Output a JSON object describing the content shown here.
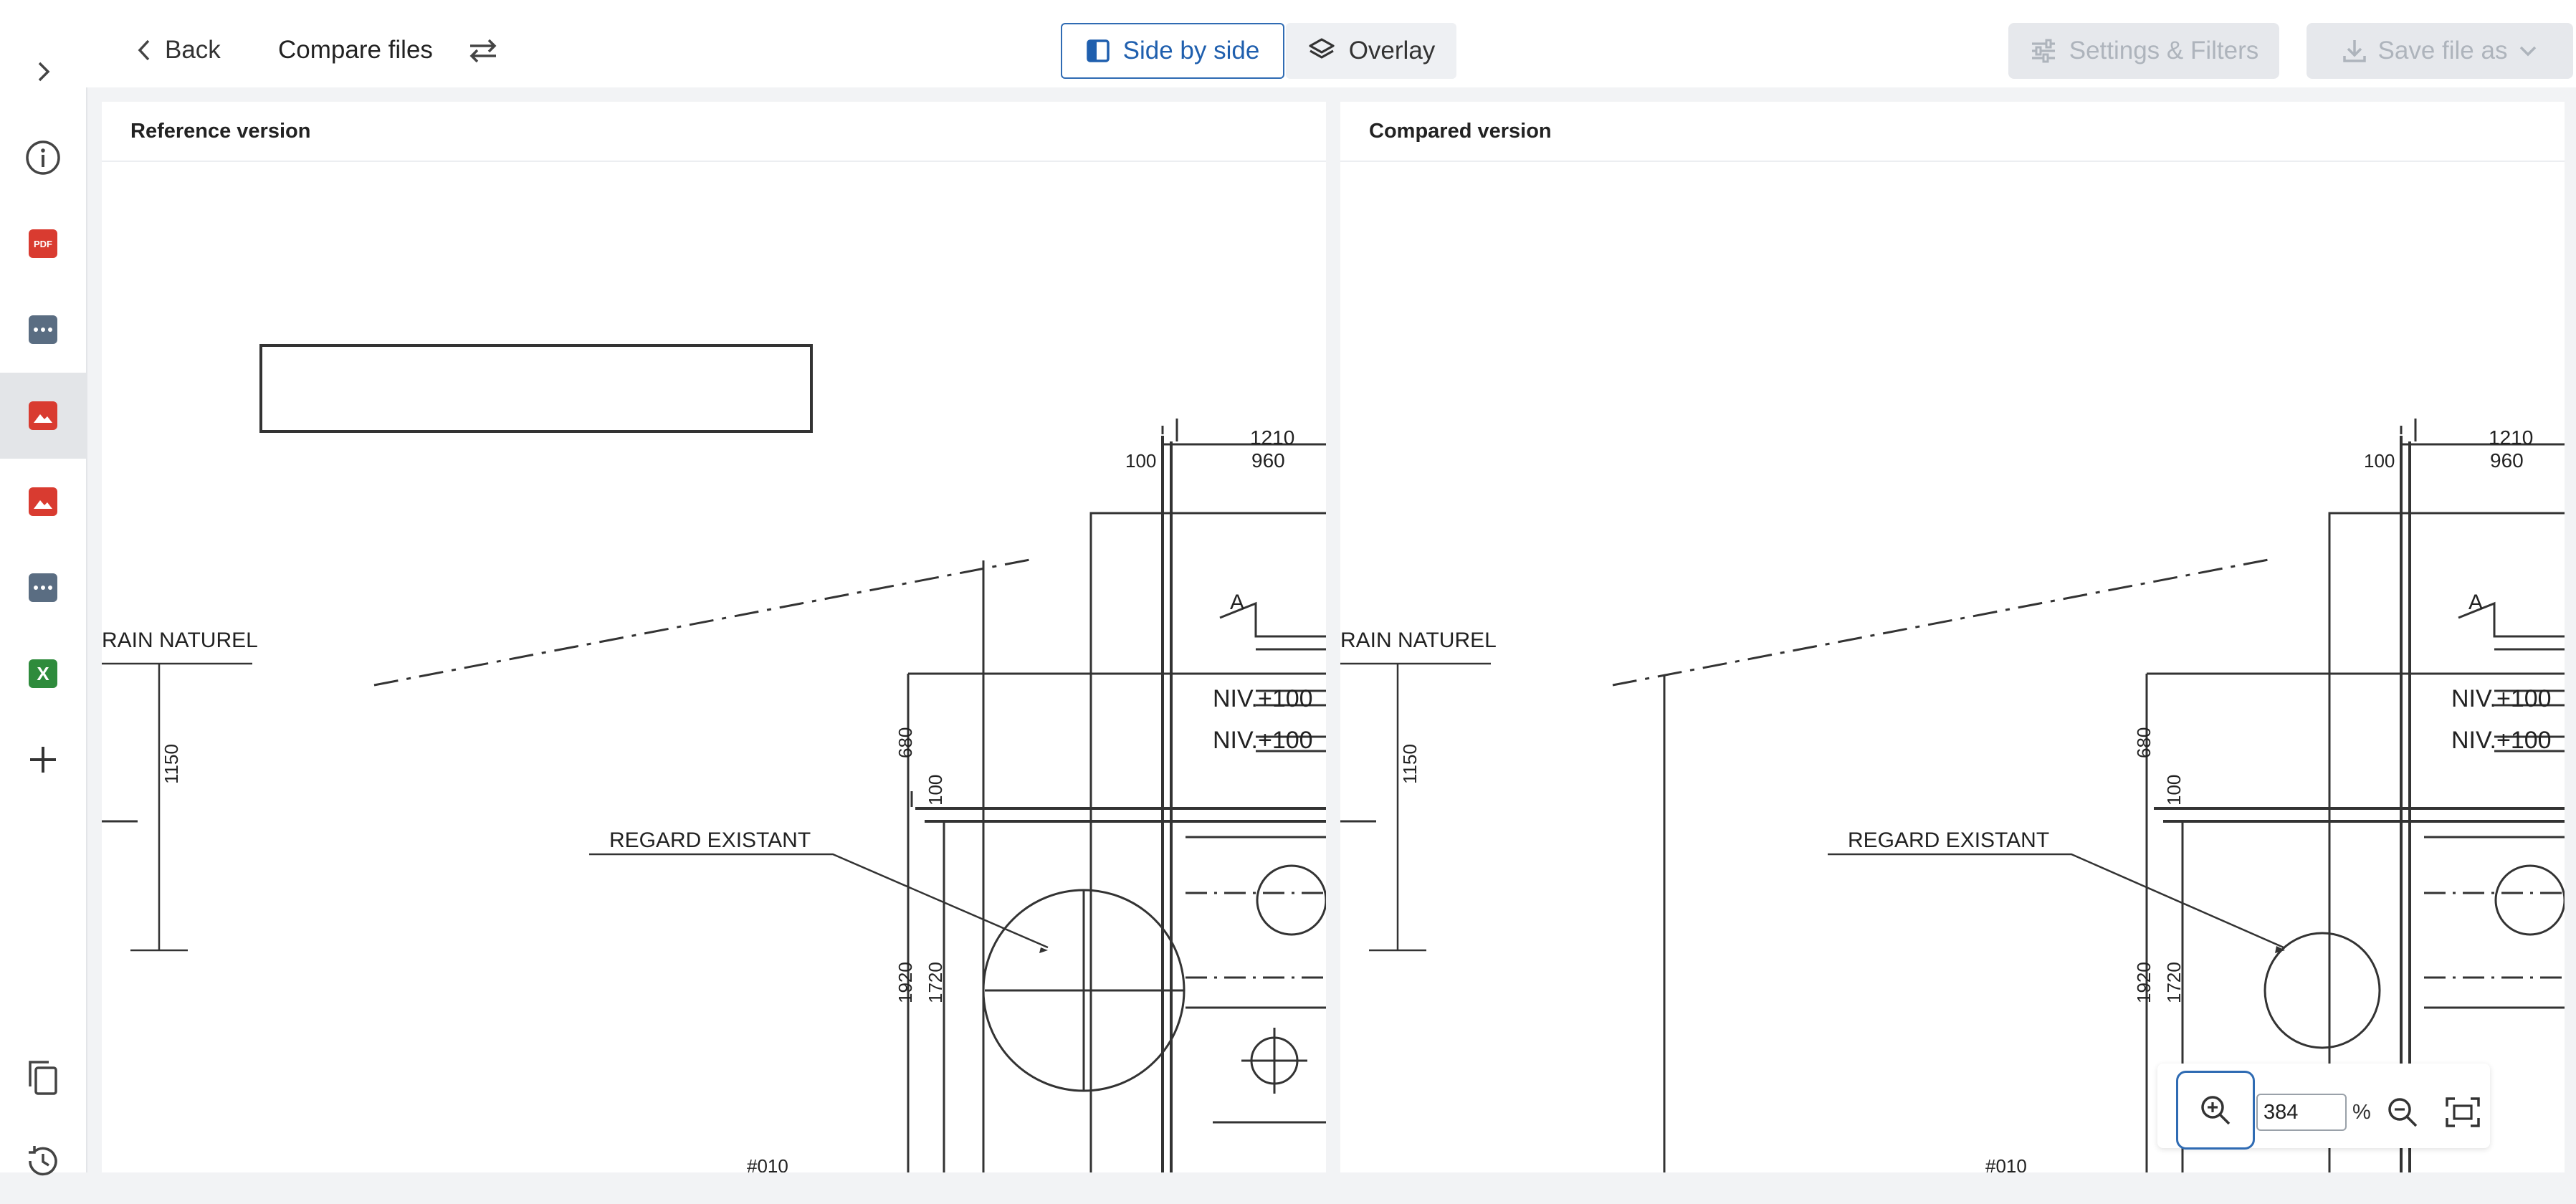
{
  "header": {
    "back_label": "Back",
    "title": "Compare files",
    "view_modes": [
      {
        "label": "Side by side",
        "selected": true
      },
      {
        "label": "Overlay",
        "selected": false
      }
    ],
    "settings_label": "Settings & Filters",
    "save_label": "Save file as"
  },
  "sidebar": {
    "items": [
      {
        "icon": "chevron-right-icon"
      },
      {
        "icon": "info-icon"
      },
      {
        "icon": "pdf-file-icon",
        "badge": "PDF",
        "color": "#d93b30"
      },
      {
        "icon": "generic-file-icon",
        "color": "#5a6d82"
      },
      {
        "icon": "image-file-icon",
        "color": "#d93b30",
        "active": true
      },
      {
        "icon": "image-file-icon",
        "color": "#d93b30"
      },
      {
        "icon": "generic-file-icon",
        "color": "#5a6d82"
      },
      {
        "icon": "excel-file-icon",
        "badge": "X",
        "color": "#2e8b3c"
      },
      {
        "icon": "plus-icon"
      },
      {
        "icon": "copy-icon"
      },
      {
        "icon": "history-icon"
      }
    ]
  },
  "panels": {
    "left": {
      "title": "Reference version"
    },
    "right": {
      "title": "Compared version"
    }
  },
  "drawing": {
    "labels": {
      "terrain": "RAIN NATUREL",
      "dim_1210": "1210",
      "dim_960": "960",
      "dim_100": "100",
      "section": "A",
      "niv1": "NIV.+100",
      "niv2": "NIV.+100",
      "dim_680": "680",
      "dim_1150": "1150",
      "regard": "REGARD EXISTANT",
      "dim_1920": "1920",
      "dim_1720": "1720",
      "code": "#010"
    }
  },
  "zoom": {
    "value": "384",
    "unit": "%"
  },
  "colors": {
    "accent": "#2f6bb3",
    "disabled": "#aeb4bc"
  }
}
